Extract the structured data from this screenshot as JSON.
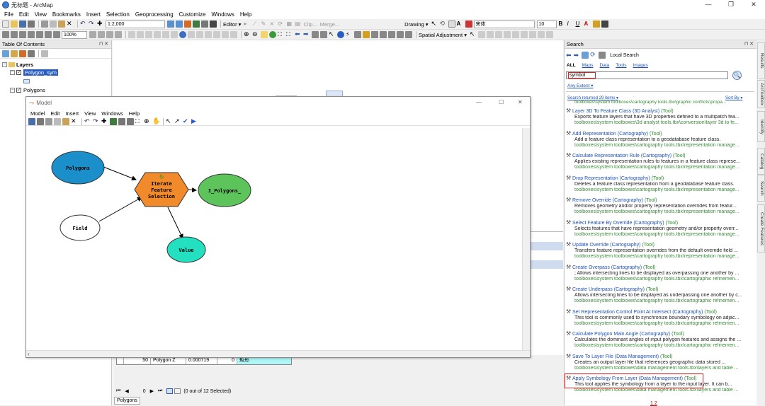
{
  "window": {
    "title": "无标题 - ArcMap",
    "min": "—",
    "max": "❐",
    "close": "✕"
  },
  "menu": [
    "File",
    "Edit",
    "View",
    "Bookmarks",
    "Insert",
    "Selection",
    "Geoprocessing",
    "Customize",
    "Windows",
    "Help"
  ],
  "toolbar": {
    "scale": "1:2,000",
    "editor_label": "Editor ▾",
    "clip_label": "Clip...",
    "merge_label": "Merge...",
    "drawing_label": "Drawing ▾",
    "font_name": "宋体",
    "font_size": "10",
    "bold": "B",
    "italic": "I",
    "underline": "U",
    "zoom_value": "100%",
    "spatial_adjustment": "Spatial Adjustment ▾"
  },
  "toc": {
    "title": "Table Of Contents",
    "pin": "⊓ ✕",
    "layers_label": "Layers",
    "layer1": "Polygon_sym",
    "layer2": "Polygons"
  },
  "model": {
    "title": "Model",
    "menu": [
      "Model",
      "Edit",
      "Insert",
      "View",
      "Windows",
      "Help"
    ],
    "nodes": {
      "polygons": "Polygons",
      "iterate_line1": "Iterate",
      "iterate_line2": "Feature",
      "iterate_line3": "Selection",
      "output": "I_Polygons_",
      "field": "Field",
      "value": "Value"
    },
    "controls": {
      "min": "—",
      "max": "☐",
      "close": "✕"
    }
  },
  "attribute_table": {
    "row": {
      "oid": "50",
      "name": "Polygon Z",
      "area": "0.000719",
      "code": "0",
      "type": "矩形"
    },
    "nav_label": "(0 out of 12 Selected)",
    "record": "0",
    "tab": "Polygons"
  },
  "search": {
    "title": "Search",
    "local_search": "Local Search",
    "filters": [
      "ALL",
      "Maps",
      "Data",
      "Tools",
      "Images"
    ],
    "query": "symbol",
    "any_extent": "Any Extent ▾",
    "returned": "Search returned 29 items ▾",
    "sort_by": "Sort By ▾",
    "pages": "1 2",
    "results": [
      {
        "name": "Layer 3D To Feature Class (3D Analyst)",
        "tag": "(Tool)",
        "desc": "Exports feature layers that have 3D properties defined to a multipatch fea...",
        "path": "toolboxes\\system toolboxes\\3d analyst tools.tbx\\conversion\\layer 3d to fe..."
      },
      {
        "name": "Add Representation (Cartography)",
        "tag": "(Tool)",
        "desc": "Add a feature class representation to a geodatabase feature class.",
        "path": "toolboxes\\system toolboxes\\cartography tools.tbx\\representation manage..."
      },
      {
        "name": "Calculate Representation Rule (Cartography)",
        "tag": "(Tool)",
        "desc": "Applies existing representation rules to features in a feature class represe...",
        "path": "toolboxes\\system toolboxes\\cartography tools.tbx\\representation manage..."
      },
      {
        "name": "Drop Representation (Cartography)",
        "tag": "(Tool)",
        "desc": "Deletes a feature class representation from a geodatabase feature class.",
        "path": "toolboxes\\system toolboxes\\cartography tools.tbx\\representation manage..."
      },
      {
        "name": "Remove Override (Cartography)",
        "tag": "(Tool)",
        "desc": "Removes geometry and/or property representation overrides from featur...",
        "path": "toolboxes\\system toolboxes\\cartography tools.tbx\\representation manage..."
      },
      {
        "name": "Select Feature By Override (Cartography)",
        "tag": "(Tool)",
        "desc": "Selects features that have representation geometry and/or property overr...",
        "path": "toolboxes\\system toolboxes\\cartography tools.tbx\\representation manage..."
      },
      {
        "name": "Update Override (Cartography)",
        "tag": "(Tool)",
        "desc": "Transfers feature representation overrides from the default override field ...",
        "path": "toolboxes\\system toolboxes\\cartography tools.tbx\\representation manage..."
      },
      {
        "name": "Create Overpass (Cartography)",
        "tag": "(Tool)",
        "desc": "; Allows intersecting lines to be displayed as overpassing one another by ...",
        "path": "toolboxes\\system toolboxes\\cartography tools.tbx\\cartographic refinemen..."
      },
      {
        "name": "Create Underpass (Cartography)",
        "tag": "(Tool)",
        "desc": "Allows intersecting lines to be displayed as underpassing one another by c...",
        "path": "toolboxes\\system toolboxes\\cartography tools.tbx\\cartographic refinemen..."
      },
      {
        "name": "Set Representation Control Point At Intersect (Cartography)",
        "tag": "(Tool)",
        "desc": "This tool is commonly used to synchronize boundary symbology on adjac...",
        "path": "toolboxes\\system toolboxes\\cartography tools.tbx\\cartographic refinemen..."
      },
      {
        "name": "Calculate Polygon Main Angle (Cartography)",
        "tag": "(Tool)",
        "desc": "Calculates the dominant angles of input polygon features and assigns the ...",
        "path": "toolboxes\\system toolboxes\\cartography tools.tbx\\cartographic refinemen..."
      },
      {
        "name": "Save To Layer File (Data Management)",
        "tag": "(Tool)",
        "desc": "Creates an output layer file that references geographic data stored ...",
        "path": "toolboxes\\system toolboxes\\data management tools.tbx\\layers and table ..."
      },
      {
        "name": "Apply Symbology From Layer (Data Management)",
        "tag": "(Tool)",
        "desc": "This tool applies the symbology from a layer to the input layer. It can b...",
        "path": "toolboxes\\system toolboxes\\data management tools.tbx\\layers and table ..."
      }
    ],
    "top_path": "toolboxes\\system toolboxes\\cartography tools.tbx\\graphic conflicts\\propa..."
  },
  "side_tabs": [
    "Results",
    "ArcToolbox",
    "Identify",
    "Catalog",
    "Search",
    "Create Features"
  ]
}
